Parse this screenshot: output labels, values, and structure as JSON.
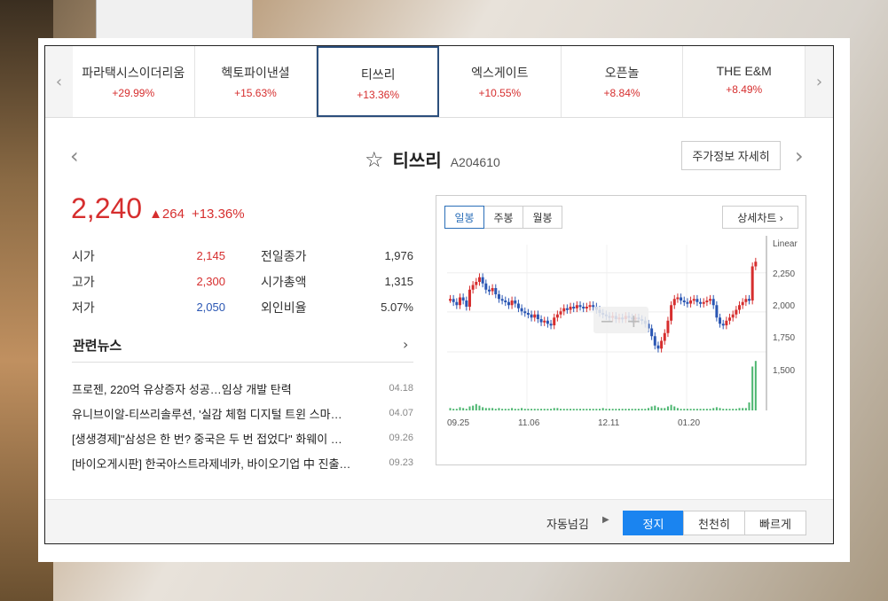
{
  "ticker": [
    {
      "name": "파라택시스이더리움",
      "change": "+29.99%"
    },
    {
      "name": "헥토파이낸셜",
      "change": "+15.63%"
    },
    {
      "name": "티쓰리",
      "change": "+13.36%"
    },
    {
      "name": "엑스게이트",
      "change": "+10.55%"
    },
    {
      "name": "오픈놀",
      "change": "+8.84%"
    },
    {
      "name": "THE E&M",
      "change": "+8.49%"
    }
  ],
  "ticker_left_arrow": "‹",
  "ticker_right_arrow": "›",
  "stock": {
    "name": "티쓰리",
    "code": "A204610",
    "detail_button": "주가정보 자세히",
    "price": "2,240",
    "delta": "▲264",
    "pct": "+13.36%"
  },
  "stats": [
    {
      "l1": "시가",
      "v1": "2,145",
      "l2": "전일종가",
      "v2": "1,976"
    },
    {
      "l1": "고가",
      "v1": "2,300",
      "l2": "시가총액",
      "v2": "1,315"
    },
    {
      "l1": "저가",
      "v1": "2,050",
      "l2": "외인비율",
      "v2": "5.07%"
    }
  ],
  "news": {
    "title": "관련뉴스",
    "items": [
      {
        "text": "프로젠, 220억 유상증자 성공…임상 개발 탄력",
        "date": "04.18"
      },
      {
        "text": "유니브이알-티쓰리솔루션, '실감 체험 디지털 트윈 스마…",
        "date": "04.07"
      },
      {
        "text": "[생생경제]\"삼성은 한 번? 중국은 두 번 접었다\" 화웨이 …",
        "date": "09.26"
      },
      {
        "text": "[바이오게시판] 한국아스트라제네카, 바이오기업 中 진출…",
        "date": "09.23"
      }
    ]
  },
  "chart_tabs": [
    "일봉",
    "주봉",
    "월봉"
  ],
  "chart_detail": "상세차트 ›",
  "chart_data": {
    "type": "candlestick",
    "scale_label": "Linear",
    "y_ticks": [
      "2,250",
      "2,000",
      "1,750",
      "1,500"
    ],
    "y_tick_values": [
      2250,
      2000,
      1750,
      1500
    ],
    "x_ticks": [
      "09.25",
      "11.06",
      "12.11",
      "01.20"
    ],
    "zoom_minus": "−",
    "zoom_plus": "+",
    "close_series": [
      2000,
      1980,
      1960,
      2010,
      1990,
      1950,
      2060,
      2090,
      2110,
      2140,
      2100,
      2060,
      2050,
      2070,
      2030,
      2000,
      1990,
      1980,
      1960,
      1990,
      1970,
      1940,
      1920,
      1910,
      1900,
      1880,
      1900,
      1870,
      1850,
      1860,
      1840,
      1830,
      1880,
      1900,
      1920,
      1940,
      1930,
      1950,
      1940,
      1960,
      1950,
      1940,
      1950,
      1960,
      1950,
      1930,
      1910,
      1900,
      1890,
      1880,
      1890,
      1870,
      1880,
      1870,
      1890,
      1880,
      1870,
      1880,
      1870,
      1860,
      1840,
      1810,
      1760,
      1700,
      1680,
      1730,
      1780,
      1860,
      1960,
      2000,
      2010,
      1990,
      1980,
      1970,
      1990,
      2000,
      1980,
      1970,
      1980,
      1990,
      2000,
      1960,
      1880,
      1840,
      1830,
      1860,
      1880,
      1900,
      1930,
      1960,
      1980,
      2000,
      1990,
      2210,
      2240
    ],
    "volume_series": [
      3,
      2,
      2,
      4,
      3,
      2,
      5,
      6,
      8,
      6,
      4,
      3,
      3,
      3,
      2,
      3,
      2,
      2,
      2,
      3,
      2,
      2,
      3,
      2,
      2,
      2,
      2,
      2,
      2,
      2,
      2,
      2,
      3,
      3,
      2,
      2,
      2,
      2,
      2,
      2,
      2,
      2,
      2,
      2,
      2,
      2,
      2,
      3,
      2,
      2,
      2,
      2,
      2,
      2,
      2,
      2,
      2,
      2,
      2,
      2,
      2,
      3,
      5,
      6,
      4,
      3,
      3,
      5,
      7,
      5,
      3,
      2,
      2,
      2,
      2,
      2,
      2,
      2,
      2,
      2,
      2,
      3,
      4,
      3,
      2,
      2,
      2,
      2,
      2,
      3,
      3,
      3,
      10,
      55,
      62
    ]
  },
  "footer": {
    "auto_label": "자동넘김",
    "arrow": "▶",
    "buttons": [
      "정지",
      "천천히",
      "빠르게"
    ]
  },
  "colors": {
    "up": "#d62e2e",
    "down": "#2a56b3",
    "volume": "#4cb670",
    "active_button": "#1a84f0"
  }
}
